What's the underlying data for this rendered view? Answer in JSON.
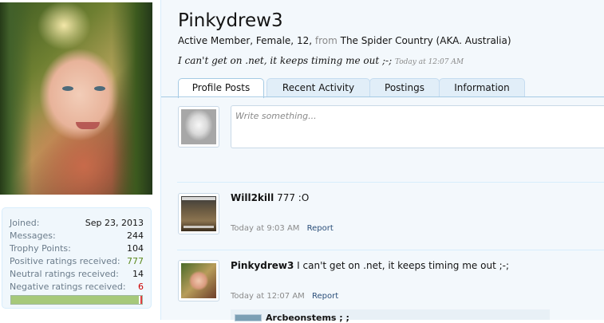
{
  "profile": {
    "username": "Pinkydrew3",
    "blurb_title": "Active Member, Female, 12,",
    "blurb_from": "from",
    "blurb_location": "The Spider Country (AKA. Australia)",
    "status_text": "I can't get on .net, it keeps timing me out ;-;",
    "status_time": "Today at 12:07 AM"
  },
  "stats": {
    "rows": [
      {
        "label": "Joined:",
        "value": "Sep 23, 2013"
      },
      {
        "label": "Messages:",
        "value": "244"
      },
      {
        "label": "Trophy Points:",
        "value": "104"
      },
      {
        "label": "Positive ratings received:",
        "value": "777"
      },
      {
        "label": "Neutral ratings received:",
        "value": "14"
      },
      {
        "label": "Negative ratings received:",
        "value": "6"
      }
    ],
    "ratings_bar": {
      "positive": 777,
      "neutral": 14,
      "negative": 6
    },
    "colors": {
      "positive": "#5c8a1e",
      "negative": "#cc0000",
      "bar_fill": "#a6c97a"
    }
  },
  "tabs": [
    {
      "label": "Profile Posts",
      "active": true
    },
    {
      "label": "Recent Activity",
      "active": false
    },
    {
      "label": "Postings",
      "active": false
    },
    {
      "label": "Information",
      "active": false
    }
  ],
  "composer": {
    "placeholder": "Write something..."
  },
  "posts": [
    {
      "author": "Will2kill",
      "message": "777 :O",
      "time": "Today at 9:03 AM",
      "report_label": "Report",
      "avatar_icon": "cat-avatar"
    },
    {
      "author": "Pinkydrew3",
      "message": "I can't get on .net, it keeps timing me out ;-;",
      "time": "Today at 12:07 AM",
      "report_label": "Report",
      "avatar_icon": "girl-avatar"
    }
  ],
  "comment": {
    "author": "Arcbeonstems ; ;"
  },
  "theme": {
    "accent": "#2b4f7a",
    "panel_bg": "#f3f8fc",
    "border": "#d7edfc"
  }
}
